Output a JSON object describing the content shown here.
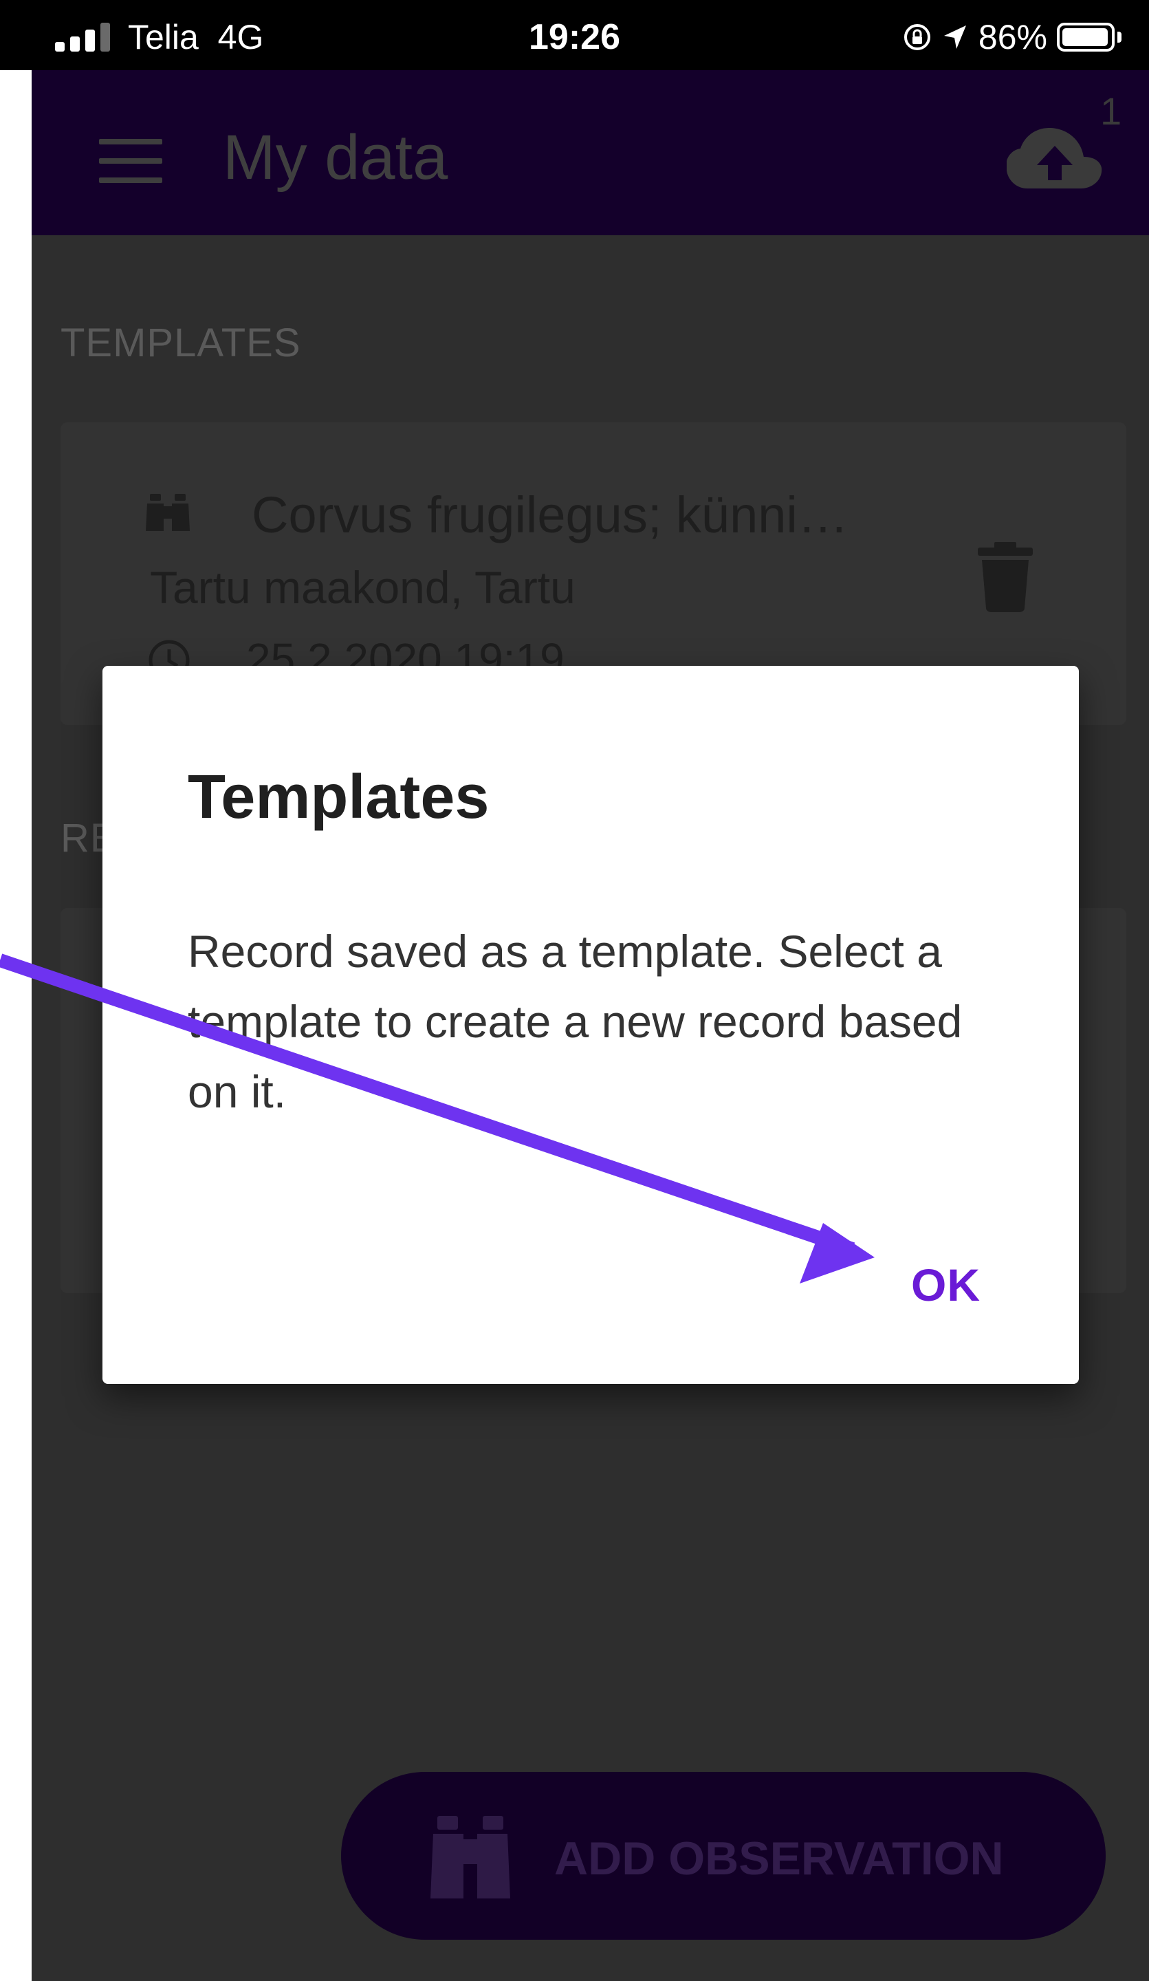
{
  "status_bar": {
    "carrier": "Telia",
    "network": "4G",
    "time": "19:26",
    "battery_percent": "86%",
    "icons": [
      "signal-icon",
      "orientation-lock-icon",
      "location-arrow-icon",
      "battery-icon"
    ]
  },
  "app_bar": {
    "title": "My data",
    "menu_icon": "hamburger-menu-icon",
    "upload_icon": "cloud-upload-icon",
    "upload_badge": "1",
    "color": "#14002b"
  },
  "templates_section": {
    "heading": "TEMPLATES",
    "card": {
      "species": "Corvus frugilegus; künni…",
      "location": "Tartu maakond, Tartu",
      "date": "25.2.2020 19:19",
      "icons": [
        "binoculars-icon",
        "clock-icon",
        "trash-icon"
      ]
    }
  },
  "records_section": {
    "heading": "RE"
  },
  "fab": {
    "label": "ADD OBSERVATION",
    "icon": "binoculars-icon"
  },
  "dialog": {
    "title": "Templates",
    "message": "Record saved as a template. Select a template to create a new record based on it.",
    "ok_label": "OK",
    "accent_color": "#6a1bd6"
  },
  "annotation": {
    "type": "arrow",
    "color": "#6e33f0",
    "points_to": "dialog-ok-button"
  }
}
